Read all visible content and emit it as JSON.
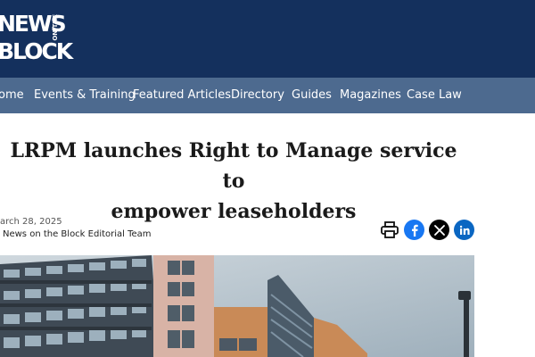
{
  "brand": {
    "word1": "NEWS",
    "word2": "BLOCK",
    "small_vertical": "ON THE"
  },
  "nav": {
    "items": [
      {
        "label": "ome"
      },
      {
        "label": "Events & Training"
      },
      {
        "label": "Featured Articles"
      },
      {
        "label": "Directory"
      },
      {
        "label": "Guides"
      },
      {
        "label": "Magazines"
      },
      {
        "label": "Case Law"
      }
    ]
  },
  "article": {
    "title_line1": "LRPM launches Right to Manage service to",
    "title_line2": "empower leaseholders",
    "date": "arch 28, 2025",
    "author": "News on the Block Editorial Team"
  },
  "share": {
    "icons": [
      "print-icon",
      "facebook-icon",
      "x-icon",
      "linkedin-icon"
    ]
  },
  "colors": {
    "header_bg": "#14305d",
    "nav_bg": "#4d6a8f",
    "facebook": "#1877f2",
    "x": "#000000",
    "linkedin": "#0a66c2"
  }
}
